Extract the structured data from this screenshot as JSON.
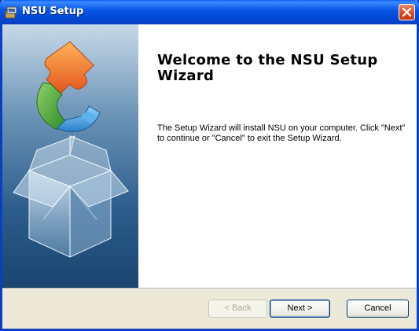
{
  "window": {
    "title": "NSU Setup"
  },
  "wizard": {
    "heading": "Welcome to the NSU Setup Wizard",
    "description": "The Setup Wizard will install NSU on your computer.  Click \"Next\" to continue or \"Cancel\" to exit the Setup Wizard."
  },
  "buttons": {
    "back": "< Back",
    "next": "Next >",
    "cancel": "Cancel"
  },
  "colors": {
    "titlebar": "#0a58e6",
    "close": "#d14a22",
    "dialog_bg": "#ece9d8",
    "banner_top": "#c7d9e8",
    "banner_bottom": "#19456f"
  },
  "icons": {
    "title": "installer-icon",
    "close": "close-icon",
    "banner": "puzzle-box-illustration"
  }
}
